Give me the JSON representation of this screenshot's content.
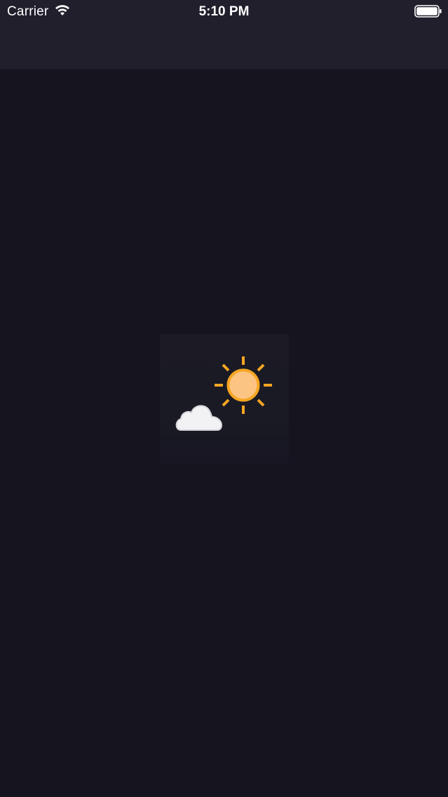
{
  "status_bar": {
    "carrier": "Carrier",
    "time": "5:10 PM",
    "wifi_icon": "wifi-icon",
    "battery_icon": "battery-icon"
  },
  "splash": {
    "icon": "partly-sunny-weather-icon",
    "sun_color": "#f6a623",
    "sun_fill": "#fcc483",
    "cloud_color": "#f2f2f4"
  },
  "colors": {
    "background": "#15141f",
    "top_bar": "#211f2c"
  }
}
